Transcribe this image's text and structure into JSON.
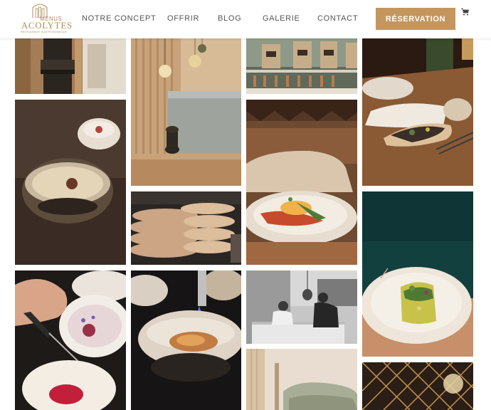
{
  "header": {
    "logo": {
      "small_text": "MENUS",
      "main_text": "ACOLYTES",
      "tagline": "RESTAURANT GASTRONOMIQUE"
    },
    "nav": [
      {
        "label": "NOTRE CONCEPT"
      },
      {
        "label": "OFFRIR"
      },
      {
        "label": "BLOG"
      },
      {
        "label": "GALERIE"
      },
      {
        "label": "CONTACT"
      }
    ],
    "reservation_label": "RÉSERVATION",
    "cart_icon": "cart-icon"
  },
  "colors": {
    "accent": "#c4965e",
    "nav_text": "#555555",
    "background": "#ffffff"
  }
}
